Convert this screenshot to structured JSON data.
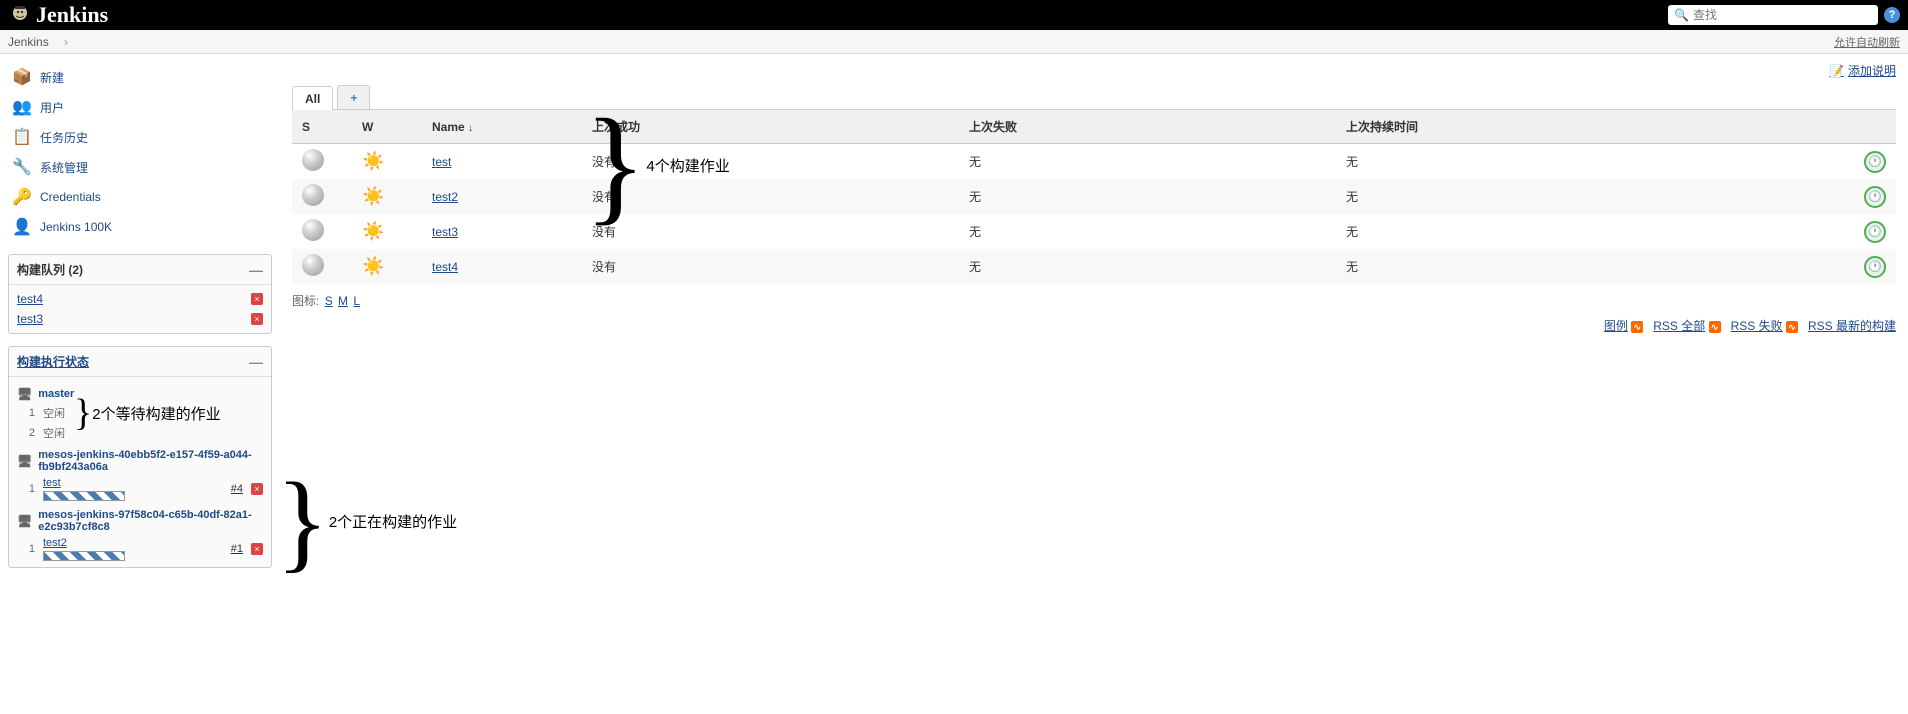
{
  "header": {
    "title": "Jenkins",
    "search_placeholder": "查找"
  },
  "breadcrumb": {
    "root": "Jenkins",
    "auto_refresh": "允许自动刷新"
  },
  "nav": {
    "items": [
      {
        "label": "新建",
        "icon": "📦"
      },
      {
        "label": "用户",
        "icon": "👥"
      },
      {
        "label": "任务历史",
        "icon": "📋"
      },
      {
        "label": "系统管理",
        "icon": "🔧"
      },
      {
        "label": "Credentials",
        "icon": "🔑"
      },
      {
        "label": "Jenkins 100K",
        "icon": "👤"
      }
    ]
  },
  "queue": {
    "title": "构建队列",
    "count": "(2)",
    "items": [
      "test4",
      "test3"
    ]
  },
  "executors": {
    "title": "构建执行状态",
    "nodes": [
      {
        "name": "master",
        "execs": [
          {
            "num": "1",
            "status": "空闲",
            "idle": true
          },
          {
            "num": "2",
            "status": "空闲",
            "idle": true
          }
        ]
      },
      {
        "name": "mesos-jenkins-40ebb5f2-e157-4f59-a044-fb9bf243a06a",
        "execs": [
          {
            "num": "1",
            "job": "test",
            "build": "#4",
            "idle": false
          }
        ]
      },
      {
        "name": "mesos-jenkins-97f58c04-c65b-40df-82a1-e2c93b7cf8c8",
        "execs": [
          {
            "num": "1",
            "job": "test2",
            "build": "#1",
            "idle": false
          }
        ]
      }
    ]
  },
  "annotations": {
    "jobs": "4个构建作业",
    "waiting": "2个等待构建的作业",
    "running": "2个正在构建的作业"
  },
  "main": {
    "add_description": "添加说明",
    "tabs": {
      "all": "All",
      "add": "+"
    },
    "columns": {
      "s": "S",
      "w": "W",
      "name": "Name",
      "sort": "↓",
      "last_success": "上次成功",
      "last_failure": "上次失败",
      "last_duration": "上次持续时间"
    },
    "jobs": [
      {
        "name": "test",
        "last_success": "没有",
        "last_failure": "无",
        "last_duration": "无"
      },
      {
        "name": "test2",
        "last_success": "没有",
        "last_failure": "无",
        "last_duration": "无"
      },
      {
        "name": "test3",
        "last_success": "没有",
        "last_failure": "无",
        "last_duration": "无"
      },
      {
        "name": "test4",
        "last_success": "没有",
        "last_failure": "无",
        "last_duration": "无"
      }
    ],
    "icon_size": {
      "label": "图标:",
      "s": "S",
      "m": "M",
      "l": "L"
    },
    "footer": {
      "legend": "图例",
      "rss_all": "RSS 全部",
      "rss_fail": "RSS 失败",
      "rss_latest": "RSS 最新的构建"
    }
  }
}
